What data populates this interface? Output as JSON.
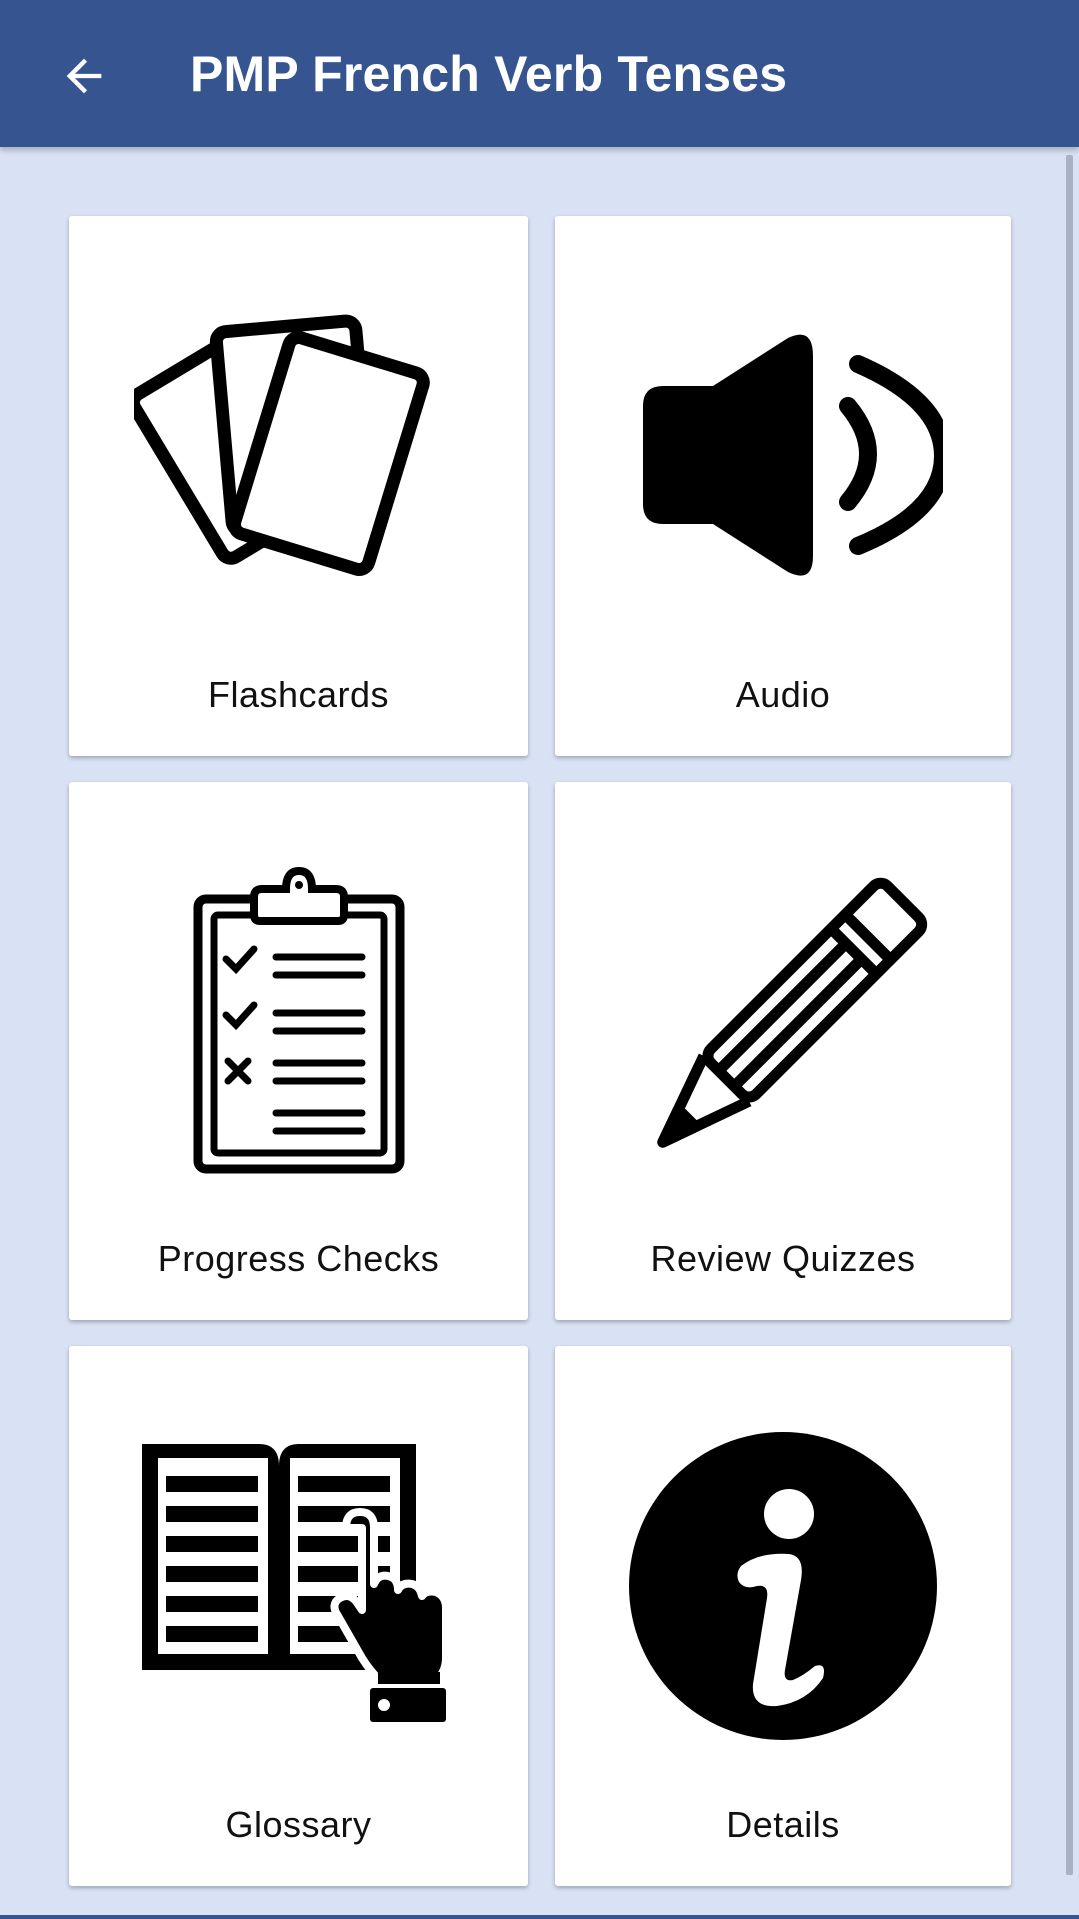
{
  "header": {
    "title": "PMP French Verb Tenses",
    "back_icon": "arrow-left-icon"
  },
  "colors": {
    "appbar": "#365490",
    "background": "#d9e2f4",
    "tile": "#ffffff",
    "icon": "#000000"
  },
  "menu": {
    "items": [
      {
        "label": "Flashcards",
        "icon": "flashcards-icon"
      },
      {
        "label": "Audio",
        "icon": "speaker-icon"
      },
      {
        "label": "Progress Checks",
        "icon": "clipboard-checklist-icon"
      },
      {
        "label": "Review Quizzes",
        "icon": "pencil-icon"
      },
      {
        "label": "Glossary",
        "icon": "book-pointer-icon"
      },
      {
        "label": "Details",
        "icon": "info-icon"
      }
    ]
  }
}
